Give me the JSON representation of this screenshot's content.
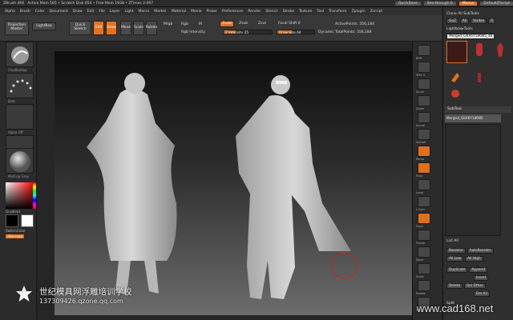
{
  "titlebar": {
    "app": "ZBrush 4R6",
    "status": "Active Mem 565 • Scratch Disk 654 • Free Mem 1938 • ZTimes 2.697",
    "quicksave": "QuickSave",
    "seethrough": "See-through 0",
    "menus": "Menus",
    "script": "DefaultZScript"
  },
  "menubar": {
    "items": [
      "Alpha",
      "Brush",
      "Color",
      "Document",
      "Draw",
      "Edit",
      "File",
      "Layer",
      "Light",
      "Macro",
      "Marker",
      "Material",
      "Movie",
      "Picker",
      "Preferences",
      "Render",
      "Stencil",
      "Stroke",
      "Texture",
      "Tool",
      "Transform",
      "Zplugin",
      "Zscript"
    ]
  },
  "toolbar": {
    "projection_master": "Projection Master",
    "lightbox": "LightBox",
    "quick_sketch": "Quick Sketch",
    "edit": "Edit",
    "draw": "Draw",
    "move": "Move",
    "scale": "Scale",
    "rotate": "Rotate",
    "mrgb": "Mrgb",
    "rgb": "Rgb",
    "m": "M",
    "zadd": "Zadd",
    "zsub": "Zsub",
    "zcut": "Zcut",
    "rgb_intensity": "Rgb Intensity",
    "z_intensity": "Z Intensity 25",
    "focal_shift": "Focal Shift 0",
    "draw_size": "Draw Size 64",
    "dynamic": "Dynamic",
    "active_points": "ActivePoints: 356,184",
    "total_points": "TotalPoints: 356,184"
  },
  "leftshelf": {
    "brush_label": "ClayBuildup",
    "stroke_label": "Dots",
    "alpha_label": "Alpha Off",
    "texture_label": "Texture Off",
    "material_label": "MatCap Gray",
    "gradient": "Gradient",
    "switch_color": "SwitchColor",
    "alternate": "Alternate"
  },
  "righttools": {
    "labels": [
      "BPR",
      "SPix 3",
      "Scroll",
      "Zoom",
      "Actual",
      "AAHalf",
      "Persp",
      "Floor",
      "Local",
      "L.Sym",
      "Gxyz",
      "Frame",
      "Move",
      "Scale",
      "Rotate",
      "PolyF",
      "Transp",
      "Ghost",
      "Solo",
      "Xpose"
    ]
  },
  "rightpanel": {
    "clone_all": "Clone All SubTools",
    "goz": "GoZ",
    "all": "All",
    "visible": "Visible",
    "r": "R",
    "lightbox_tools": "Lightbox▸Tools",
    "merged_name": "Merged_G6X6Y186N5_48",
    "tool1": "Merged_G6",
    "tool2": "Cylinder3D",
    "tool3": "PM3D_Merged",
    "tool4": "SimpleBrush",
    "tool5": "Merged_G6X6",
    "tool6": "QSphere3D",
    "subtool": "SubTool",
    "subtool_item": "Merged_G6X6Y186N5",
    "list_all": "List All",
    "rename": "Rename",
    "autoreorder": "AutoReorder",
    "all_low": "All Low",
    "all_high": "All High",
    "duplicate": "Duplicate",
    "append": "Append",
    "insert": "Insert",
    "delete": "Delete",
    "del_other": "Del Other",
    "del_all": "Del All",
    "split": "Split"
  },
  "watermark": {
    "title": "世纪模具网浮雕培训学校",
    "subtitle": "137309426.qzone.qq.com",
    "site": "www.cad168.net"
  },
  "colors": {
    "accent": "#e0701a",
    "panel": "#2f2f2f",
    "background": "#1f1f1f"
  }
}
